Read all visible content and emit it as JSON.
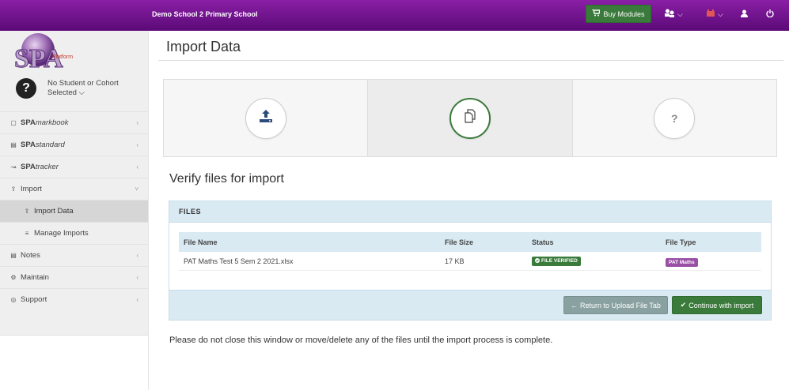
{
  "header": {
    "school_name": "Demo School 2 Primary School",
    "buy_label": "Buy Modules",
    "brand_color": "#6a1487",
    "icons": [
      "cart-icon",
      "group-icon",
      "notification-icon",
      "user-icon",
      "power-icon"
    ]
  },
  "sidebar": {
    "logo_text": "SPA",
    "logo_sub": "Platform",
    "student_line1": "No Student or Cohort",
    "student_line2": "Selected",
    "items": [
      {
        "prefix": "SPA",
        "suffix": "markbook",
        "icon": "book-icon"
      },
      {
        "prefix": "SPA",
        "suffix": "standard",
        "icon": "bar-chart-icon"
      },
      {
        "prefix": "SPA",
        "suffix": "tracker",
        "icon": "line-chart-icon"
      },
      {
        "label": "Import",
        "icon": "upload-icon"
      },
      {
        "label": "Import Data",
        "icon": "upload-icon"
      },
      {
        "label": "Manage Imports",
        "icon": "list-icon"
      },
      {
        "label": "Notes",
        "icon": "file-icon"
      },
      {
        "label": "Maintain",
        "icon": "cogs-icon"
      },
      {
        "label": "Support",
        "icon": "lifebuoy-icon"
      }
    ]
  },
  "main": {
    "page_title": "Import Data",
    "steps": [
      {
        "icon": "upload-icon",
        "state": "done"
      },
      {
        "icon": "copy-files-icon",
        "state": "current"
      },
      {
        "label": "?",
        "icon": "question-icon",
        "state": "pending"
      }
    ],
    "section_title": "Verify files for import",
    "panel_title": "FILES",
    "columns": [
      "File Name",
      "File Size",
      "Status",
      "File Type"
    ],
    "files": [
      {
        "name": "PAT Maths Test 5 Sem 2 2021.xlsx",
        "size": "17 KB",
        "status": "FILE VERIFIED",
        "type": "PAT Maths"
      }
    ],
    "return_label": "Return to Upload File Tab",
    "continue_label": "Continue with import",
    "note": "Please do not close this window or move/delete any of the files until the import process is complete."
  }
}
